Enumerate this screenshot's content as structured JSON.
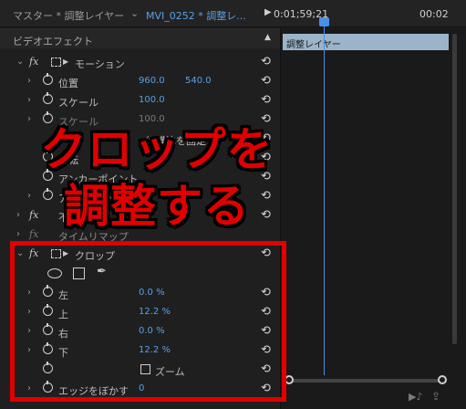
{
  "tabs": {
    "master": "マスター * 調整レイヤー",
    "chevron": "⌄",
    "clip": "MVI_0252 * 調整レ...",
    "play": "▶",
    "time_start": "0:01;59;21",
    "time_end": "00:02"
  },
  "effects": {
    "title": "ビデオエフェクト",
    "rows": [
      {
        "label": "モーション"
      },
      {
        "label": "位置",
        "value1": "960.0",
        "value2": "540.0"
      },
      {
        "label": "スケール",
        "value1": "100.0"
      },
      {
        "label": "スケール",
        "value1": "100.0"
      },
      {
        "label": "縦横比を固定"
      },
      {
        "label": "回転"
      },
      {
        "label": "アンカーポイント"
      },
      {
        "label": "アンチフリッカー"
      },
      {
        "label": "不透明度"
      },
      {
        "label": "タイムリマップ"
      },
      {
        "label": "クロップ"
      },
      {
        "label": "左",
        "value1": "0.0 %"
      },
      {
        "label": "上",
        "value1": "12.2 %"
      },
      {
        "label": "右",
        "value1": "0.0 %"
      },
      {
        "label": "下",
        "value1": "12.2 %"
      },
      {
        "label": "ズーム"
      },
      {
        "label": "エッジをぼかす",
        "value1": "0"
      }
    ]
  },
  "timeline": {
    "clip_label": "調整レイヤー"
  },
  "overlay": {
    "line1": "クロップを",
    "line2": "調整する"
  },
  "icons": {
    "twirl": "›",
    "twirl_open": "⌄",
    "fx": "fx",
    "reset": "⟲",
    "collapse": "▲",
    "pen": "✒",
    "motion_arrow": "▶",
    "audio": "▶♪",
    "export": "⇪"
  },
  "colors": {
    "value_blue": "#5aa0e8",
    "overlay_red": "#e00000",
    "clip_bar": "#9bb4c9"
  }
}
